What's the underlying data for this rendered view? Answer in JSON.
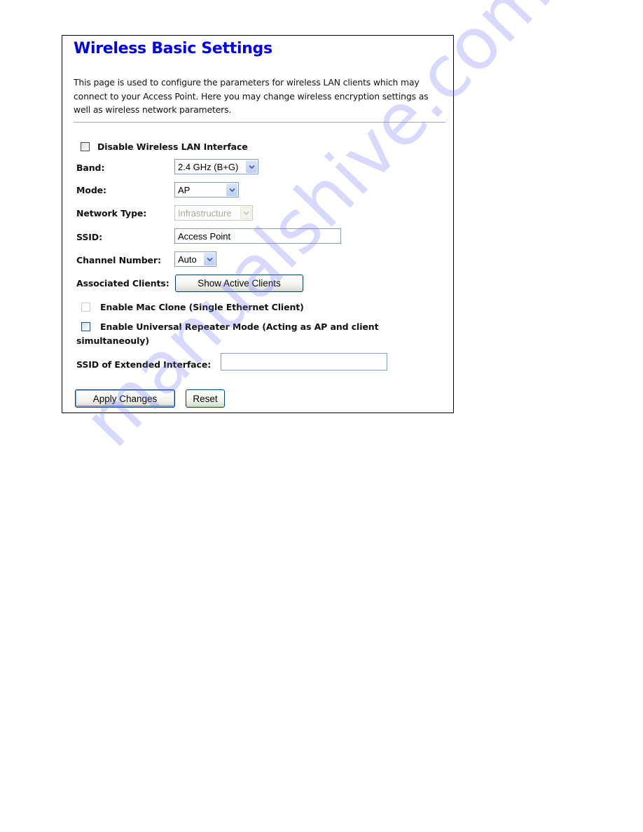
{
  "page": {
    "title": "Wireless Basic Settings",
    "description": "This page is used to configure the parameters for wireless LAN clients which may connect to your Access Point. Here you may change wireless encryption settings as well as wireless network parameters."
  },
  "form": {
    "disable_wlan": {
      "label": "Disable Wireless LAN Interface",
      "checked": false
    },
    "band": {
      "label": "Band:",
      "value": "2.4 GHz (B+G)"
    },
    "mode": {
      "label": "Mode:",
      "value": "AP"
    },
    "network_type": {
      "label": "Network Type:",
      "value": "Infrastructure",
      "disabled": true
    },
    "ssid": {
      "label": "SSID:",
      "value": "Access Point"
    },
    "channel": {
      "label": "Channel Number:",
      "value": "Auto"
    },
    "associated_clients": {
      "label": "Associated Clients:",
      "button": "Show Active Clients"
    },
    "mac_clone": {
      "label": "Enable Mac Clone (Single Ethernet Client)",
      "checked": false,
      "disabled": true
    },
    "universal_repeater": {
      "label_line1": "Enable Universal Repeater Mode (Acting as AP and client",
      "label_line2": "simultaneouly)",
      "checked": false
    },
    "extended_ssid": {
      "label": "SSID of Extended Interface:",
      "value": ""
    }
  },
  "actions": {
    "apply": "Apply Changes",
    "reset": "Reset"
  },
  "watermark": "manualshive.com"
}
